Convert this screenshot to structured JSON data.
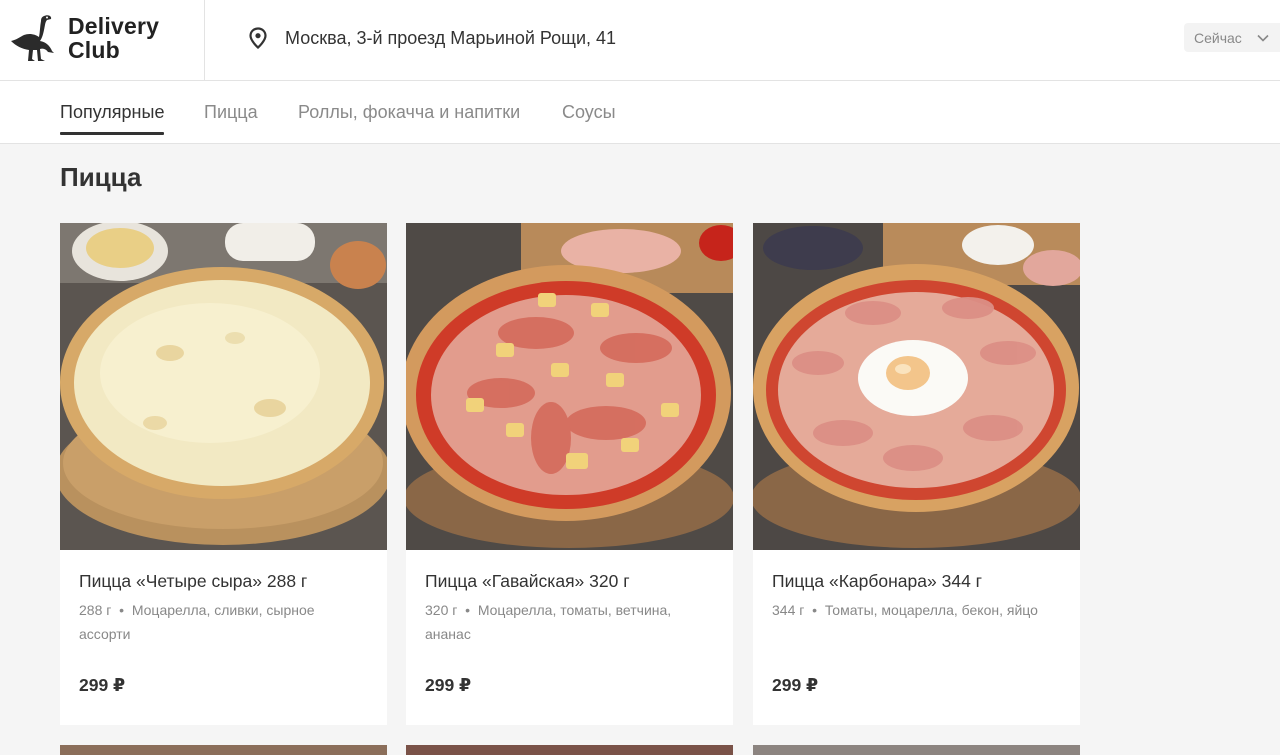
{
  "header": {
    "logo_line1": "Delivery",
    "logo_line2": "Club",
    "address": "Москва, 3-й проезд Марьиной Рощи, 41",
    "time_label": "Сейчас"
  },
  "tabs": [
    {
      "label": "Популярные",
      "active": true
    },
    {
      "label": "Пицца",
      "active": false
    },
    {
      "label": "Роллы, фокачча и напитки",
      "active": false
    },
    {
      "label": "Соусы",
      "active": false
    }
  ],
  "section": {
    "title": "Пицца",
    "products": [
      {
        "name": "Пицца «Четыре сыра» 288 г",
        "weight": "288 г",
        "ingredients": "Моцарелла, сливки, сырное ассорти",
        "price": "299 ₽",
        "image": "four-cheese-pizza"
      },
      {
        "name": "Пицца «Гавайская» 320 г",
        "weight": "320 г",
        "ingredients": "Моцарелла, томаты, ветчина, ананас",
        "price": "299 ₽",
        "image": "hawaiian-pizza"
      },
      {
        "name": "Пицца «Карбонара» 344 г",
        "weight": "344 г",
        "ingredients": "Томаты, моцарелла, бекон, яйцо",
        "price": "299 ₽",
        "image": "carbonara-pizza"
      }
    ]
  },
  "icons": {
    "logo": "ostrich-icon",
    "location": "location-pin-icon",
    "dropdown": "chevron-down-icon"
  },
  "colors": {
    "background": "#f5f5f5",
    "text": "#333333",
    "muted": "#8a8a8a"
  }
}
